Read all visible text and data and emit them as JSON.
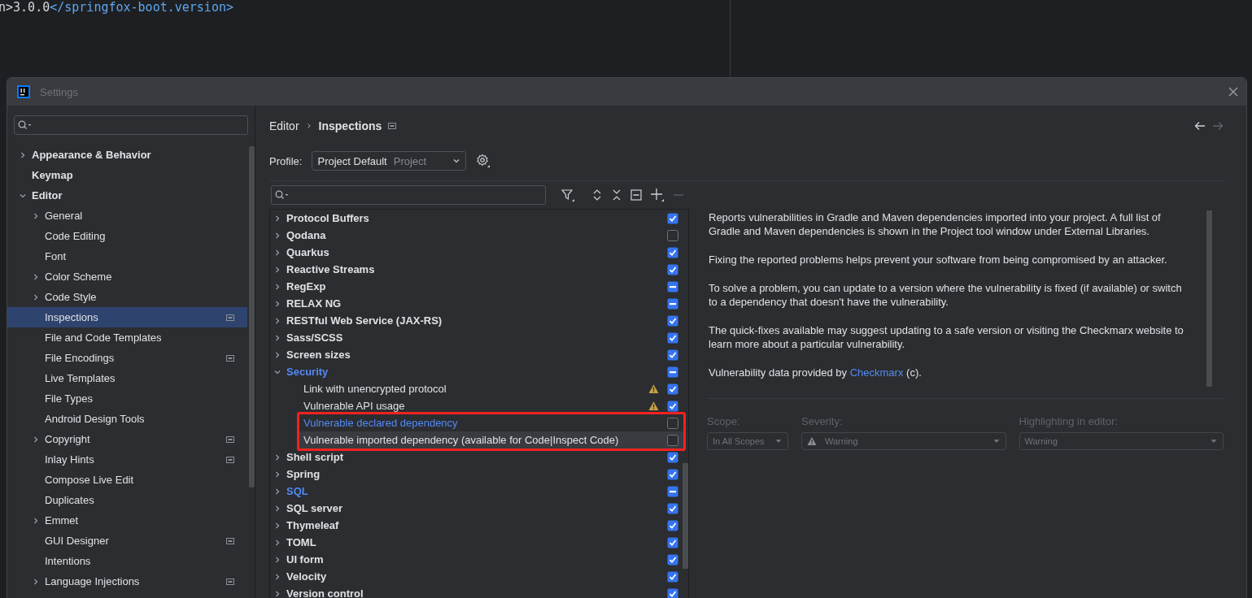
{
  "editor_line": {
    "parts": [
      {
        "kind": "text",
        "text": "n>3.0.0"
      },
      {
        "kind": "tag",
        "text": "</springfox-boot.version>"
      }
    ]
  },
  "window": {
    "title": "Settings"
  },
  "sidebar": {
    "items": [
      {
        "label": "Appearance & Behavior",
        "expandable": true,
        "expanded": false,
        "selected": false,
        "project_badge": false
      },
      {
        "label": "Keymap",
        "expandable": false,
        "selected": false,
        "project_badge": false
      },
      {
        "label": "Editor",
        "expandable": true,
        "expanded": true,
        "selected": false,
        "project_badge": false,
        "children": [
          {
            "label": "General",
            "expandable": true,
            "selected": false,
            "project_badge": false
          },
          {
            "label": "Code Editing",
            "expandable": false,
            "selected": false,
            "project_badge": false
          },
          {
            "label": "Font",
            "expandable": false,
            "selected": false,
            "project_badge": false
          },
          {
            "label": "Color Scheme",
            "expandable": true,
            "selected": false,
            "project_badge": false
          },
          {
            "label": "Code Style",
            "expandable": true,
            "selected": false,
            "project_badge": false
          },
          {
            "label": "Inspections",
            "expandable": false,
            "selected": true,
            "project_badge": true
          },
          {
            "label": "File and Code Templates",
            "expandable": false,
            "selected": false,
            "project_badge": false
          },
          {
            "label": "File Encodings",
            "expandable": false,
            "selected": false,
            "project_badge": true
          },
          {
            "label": "Live Templates",
            "expandable": false,
            "selected": false,
            "project_badge": false
          },
          {
            "label": "File Types",
            "expandable": false,
            "selected": false,
            "project_badge": false
          },
          {
            "label": "Android Design Tools",
            "expandable": false,
            "selected": false,
            "project_badge": false
          },
          {
            "label": "Copyright",
            "expandable": true,
            "selected": false,
            "project_badge": true
          },
          {
            "label": "Inlay Hints",
            "expandable": false,
            "selected": false,
            "project_badge": true
          },
          {
            "label": "Compose Live Edit",
            "expandable": false,
            "selected": false,
            "project_badge": false
          },
          {
            "label": "Duplicates",
            "expandable": false,
            "selected": false,
            "project_badge": false
          },
          {
            "label": "Emmet",
            "expandable": true,
            "selected": false,
            "project_badge": false
          },
          {
            "label": "GUI Designer",
            "expandable": false,
            "selected": false,
            "project_badge": true
          },
          {
            "label": "Intentions",
            "expandable": false,
            "selected": false,
            "project_badge": false
          },
          {
            "label": "Language Injections",
            "expandable": true,
            "selected": false,
            "project_badge": true
          }
        ]
      }
    ]
  },
  "breadcrumb": [
    {
      "label": "Editor"
    },
    {
      "label": "Inspections"
    }
  ],
  "profile": {
    "label": "Profile:",
    "value": "Project Default",
    "scope": "Project"
  },
  "inspections": [
    {
      "label": "Protocol Buffers",
      "expanded": false,
      "checked": true,
      "mixed": false,
      "modified": false
    },
    {
      "label": "Qodana",
      "expanded": false,
      "checked": false,
      "mixed": false,
      "modified": false
    },
    {
      "label": "Quarkus",
      "expanded": false,
      "checked": true,
      "mixed": false,
      "modified": false
    },
    {
      "label": "Reactive Streams",
      "expanded": false,
      "checked": true,
      "mixed": false,
      "modified": false
    },
    {
      "label": "RegExp",
      "expanded": false,
      "mixed": true,
      "modified": false
    },
    {
      "label": "RELAX NG",
      "expanded": false,
      "mixed": true,
      "modified": false
    },
    {
      "label": "RESTful Web Service (JAX-RS)",
      "expanded": false,
      "checked": true,
      "mixed": false,
      "modified": false
    },
    {
      "label": "Sass/SCSS",
      "expanded": false,
      "checked": true,
      "mixed": false,
      "modified": false
    },
    {
      "label": "Screen sizes",
      "expanded": false,
      "checked": true,
      "mixed": false,
      "modified": false
    },
    {
      "label": "Security",
      "expanded": true,
      "mixed": true,
      "modified": true,
      "children": [
        {
          "label": "Link with unencrypted protocol",
          "warning": true,
          "checked": true,
          "modified": false,
          "selected": false
        },
        {
          "label": "Vulnerable API usage",
          "warning": true,
          "checked": true,
          "modified": false,
          "selected": false
        },
        {
          "label": "Vulnerable declared dependency",
          "warning": false,
          "checked": false,
          "modified": true,
          "selected": false,
          "highlighted": true
        },
        {
          "label": "Vulnerable imported dependency (available for Code|Inspect Code)",
          "warning": false,
          "checked": false,
          "modified": false,
          "selected": true,
          "highlighted": true
        }
      ]
    },
    {
      "label": "Shell script",
      "expanded": false,
      "checked": true,
      "mixed": false,
      "modified": false
    },
    {
      "label": "Spring",
      "expanded": false,
      "checked": true,
      "mixed": false,
      "modified": false
    },
    {
      "label": "SQL",
      "expanded": false,
      "mixed": true,
      "modified": true
    },
    {
      "label": "SQL server",
      "expanded": false,
      "checked": true,
      "mixed": false,
      "modified": false
    },
    {
      "label": "Thymeleaf",
      "expanded": false,
      "checked": true,
      "mixed": false,
      "modified": false
    },
    {
      "label": "TOML",
      "expanded": false,
      "checked": true,
      "mixed": false,
      "modified": false
    },
    {
      "label": "UI form",
      "expanded": false,
      "checked": true,
      "mixed": false,
      "modified": false
    },
    {
      "label": "Velocity",
      "expanded": false,
      "checked": true,
      "mixed": false,
      "modified": false
    },
    {
      "label": "Version control",
      "expanded": false,
      "checked": true,
      "mixed": false,
      "modified": false
    }
  ],
  "description": [
    {
      "text": "Reports vulnerabilities in Gradle and Maven dependencies imported into your project. A full list of Gradle and Maven dependencies is shown in the Project tool window under External Libraries."
    },
    {
      "text": "Fixing the reported problems helps prevent your software from being compromised by an attacker."
    },
    {
      "text": "To solve a problem, you can update to a version where the vulnerability is fixed (if available) or switch to a dependency that doesn't have the vulnerability."
    },
    {
      "text": "The quick-fixes available may suggest updating to a safe version or visiting the Checkmarx website to learn more about a particular vulnerability."
    },
    {
      "text": "Vulnerability data provided by",
      "link": "Checkmarx",
      "after": "(c)."
    }
  ],
  "options": [
    {
      "label": "Scope:",
      "value": "In All Scopes",
      "warning_icon": false,
      "disabled": true,
      "kind": "narrow"
    },
    {
      "label": "Severity:",
      "value": "Warning",
      "warning_icon": true,
      "disabled": true,
      "kind": "wide"
    },
    {
      "label": "Highlighting in editor:",
      "value": "Warning",
      "warning_icon": false,
      "disabled": true,
      "kind": "wide"
    }
  ]
}
